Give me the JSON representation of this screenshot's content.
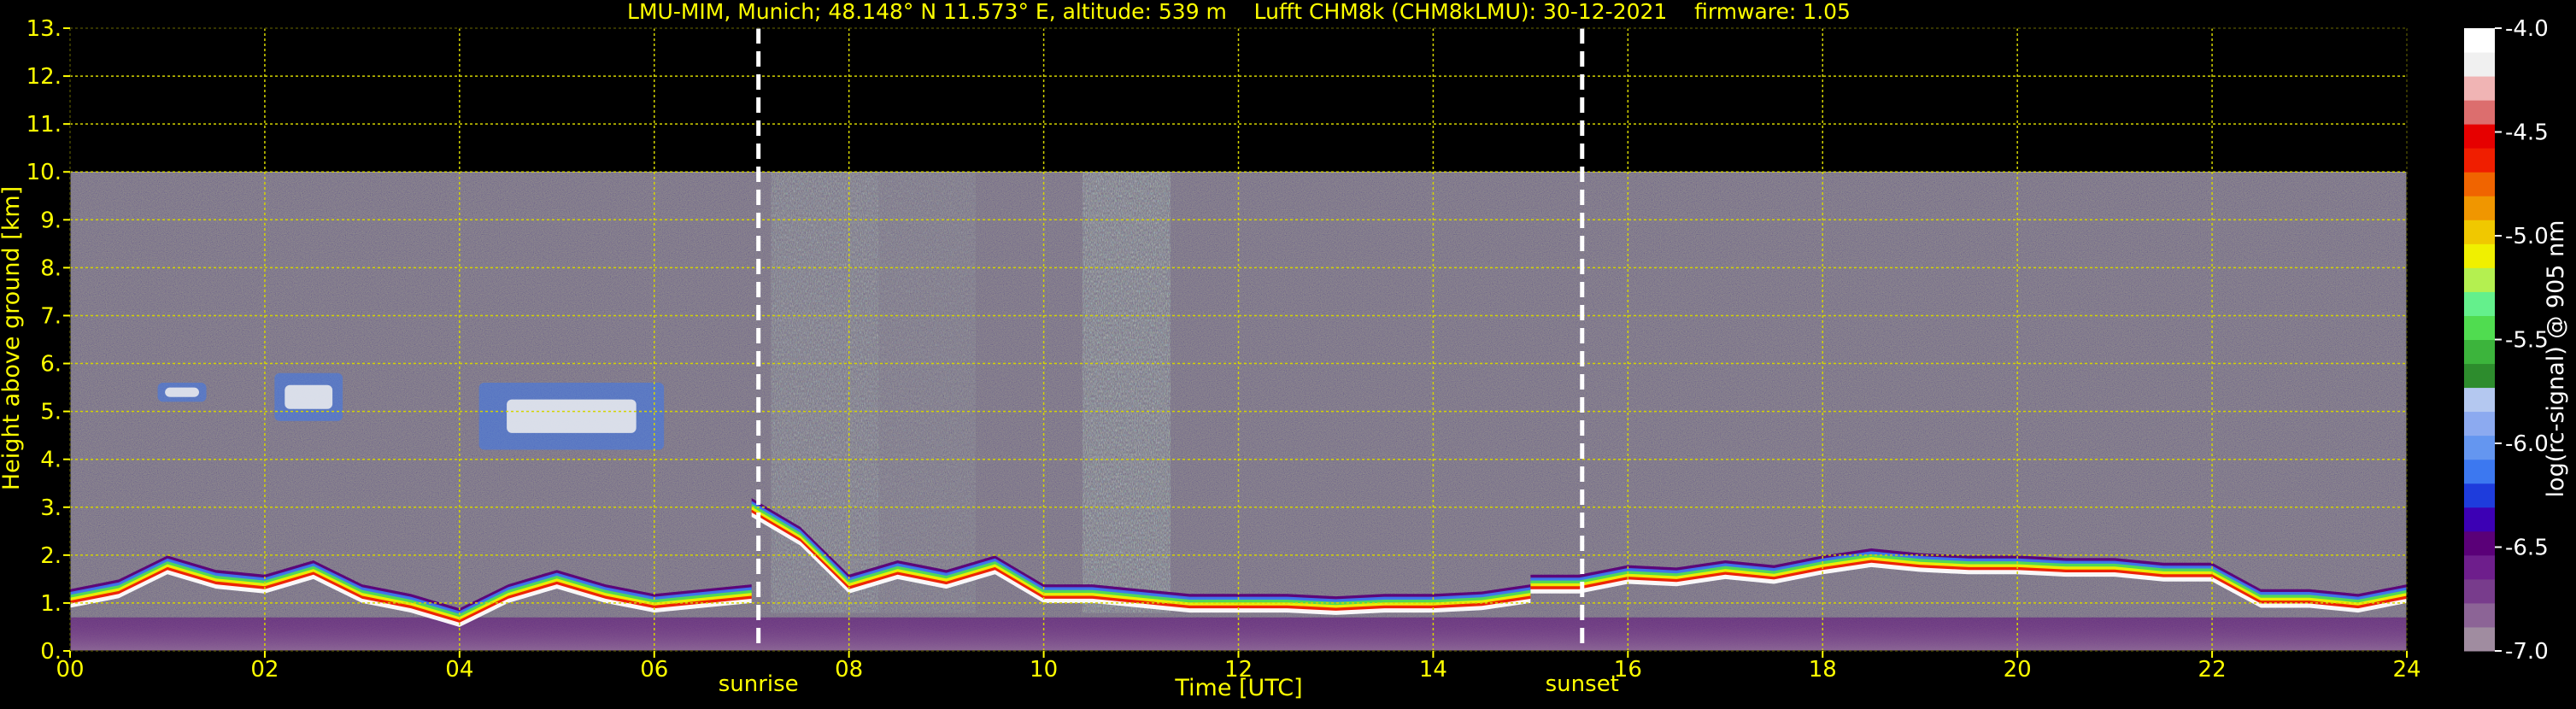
{
  "chart_data": {
    "type": "heatmap",
    "title": "LMU-MIM, Munich; 48.148° N 11.573° E, altitude: 539 m    Lufft CHM8k (CHM8kLMU): 30-12-2021    firmware: 1.05",
    "xlabel": "Time [UTC]",
    "ylabel": "Height above ground [km]",
    "xlim": [
      0,
      24
    ],
    "ylim": [
      0,
      13
    ],
    "x_ticks": [
      "00",
      "02",
      "04",
      "06",
      "08",
      "10",
      "12",
      "14",
      "16",
      "18",
      "20",
      "22",
      "24"
    ],
    "y_ticks": [
      "0.",
      "1.",
      "2.",
      "3.",
      "4.",
      "5.",
      "6.",
      "7.",
      "8.",
      "9.",
      "10.",
      "11.",
      "12.",
      "13."
    ],
    "grid": true,
    "grid_color": "#d4d400",
    "markers": [
      {
        "label": "sunrise",
        "x": 7.07
      },
      {
        "label": "sunset",
        "x": 15.53
      }
    ],
    "colorbar": {
      "label": "log(rc-signal) @ 905 nm",
      "range": [
        -7.0,
        -4.0
      ],
      "ticks": [
        "-4.0",
        "-4.5",
        "-5.0",
        "-5.5",
        "-6.0",
        "-6.5",
        "-7.0"
      ],
      "colors": [
        "#a08ca0",
        "#8c6496",
        "#783c8c",
        "#6e1e8c",
        "#5a0078",
        "#3c00b4",
        "#1e3cdc",
        "#3c78f0",
        "#6496f0",
        "#8caaf0",
        "#b4c8f0",
        "#2d8c2d",
        "#3cb43c",
        "#50dc50",
        "#64f08c",
        "#b4f050",
        "#f0f000",
        "#f0c800",
        "#f09600",
        "#f06400",
        "#f01e00",
        "#e60000",
        "#dc6e6e",
        "#f0b4b4",
        "#f0f0f0",
        "#ffffff"
      ]
    },
    "cloud_layers": [
      {
        "x": [
          0.0,
          0.5,
          1.0,
          1.5,
          2.0,
          2.5,
          3.0,
          3.5,
          4.0,
          4.5,
          5.0,
          5.5,
          6.0,
          6.5,
          7.0
        ],
        "base_km": [
          0.9,
          1.1,
          1.6,
          1.3,
          1.2,
          1.5,
          1.0,
          0.8,
          0.5,
          1.0,
          1.3,
          1.0,
          0.8,
          0.9,
          1.0
        ]
      },
      {
        "x": [
          7.0,
          7.5,
          8.0,
          8.5,
          9.0,
          9.5,
          10.0,
          10.5,
          11.0,
          11.5,
          12.0,
          12.5,
          13.0,
          13.5,
          14.0,
          14.5,
          15.0
        ],
        "base_km": [
          2.8,
          2.2,
          1.2,
          1.5,
          1.3,
          1.6,
          1.0,
          1.0,
          0.9,
          0.8,
          0.8,
          0.8,
          0.75,
          0.8,
          0.8,
          0.85,
          1.0
        ]
      },
      {
        "x": [
          15.0,
          15.5,
          16.0,
          16.5,
          17.0,
          17.5,
          18.0,
          18.5,
          19.0,
          19.5,
          20.0,
          20.5,
          21.0,
          21.5,
          22.0,
          22.5,
          23.0,
          23.5,
          24.0
        ],
        "base_km": [
          1.2,
          1.2,
          1.4,
          1.35,
          1.5,
          1.4,
          1.6,
          1.75,
          1.65,
          1.6,
          1.6,
          1.55,
          1.55,
          1.45,
          1.45,
          0.9,
          0.9,
          0.8,
          1.0
        ]
      }
    ],
    "elevated_cloud_patches": [
      {
        "x": [
          0.9,
          1.4
        ],
        "height_km": [
          5.2,
          5.6
        ]
      },
      {
        "x": [
          2.1,
          2.8
        ],
        "height_km": [
          4.8,
          5.8
        ]
      },
      {
        "x": [
          4.2,
          6.1
        ],
        "height_km": [
          4.2,
          5.6
        ]
      }
    ]
  }
}
